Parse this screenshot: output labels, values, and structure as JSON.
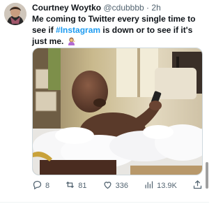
{
  "tweet": {
    "author_name": "Courtney Woytko",
    "handle": "@cdubbbb",
    "separator": "·",
    "time": "2h",
    "text_part1": "Me coming to Twitter every single time to see if ",
    "hashtag": "#Instagram",
    "text_part2": " is down or to see if it's just me.",
    "emoji_icon": "woman-tipping-hand-icon"
  },
  "actions": {
    "replies": "8",
    "retweets": "81",
    "likes": "336",
    "views": "13.9K"
  },
  "colors": {
    "link": "#1d9bf0",
    "secondary_text": "#536471"
  }
}
